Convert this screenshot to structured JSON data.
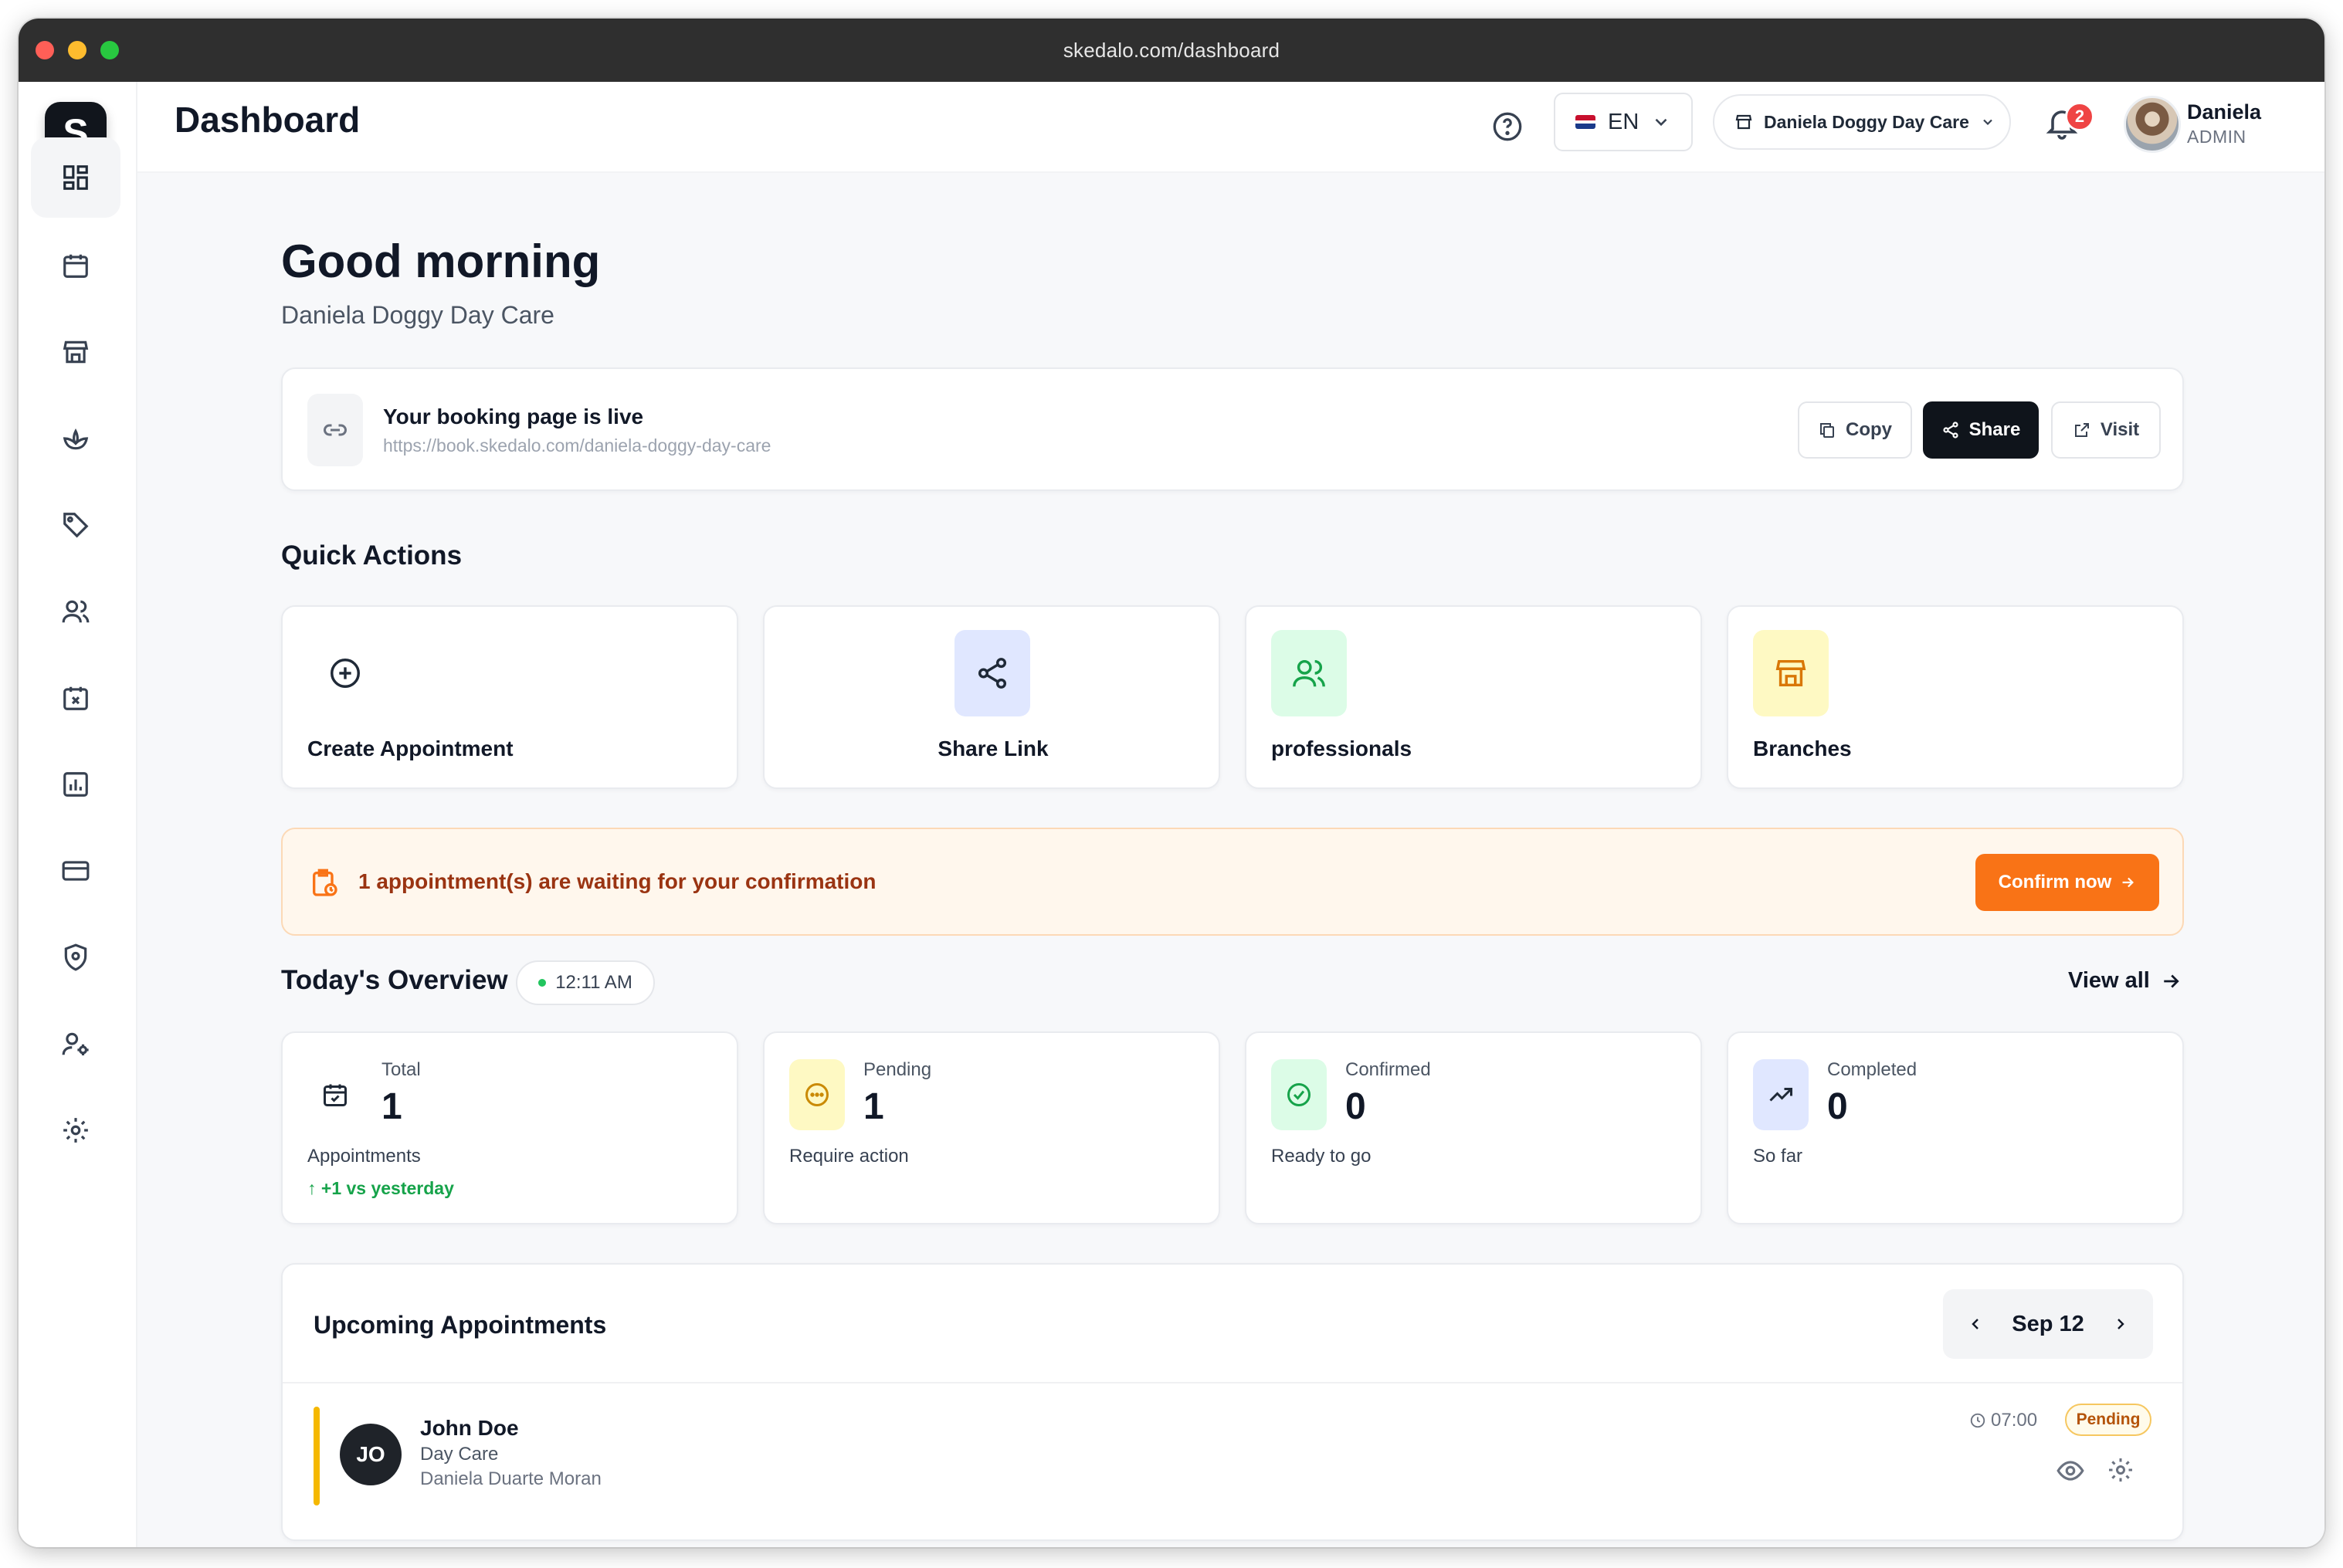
{
  "browser": {
    "url": "skedalo.com/dashboard"
  },
  "logo": {
    "letter": "S"
  },
  "sidebar": {
    "items": [
      {
        "icon": "dashboard-icon",
        "active": true
      },
      {
        "icon": "calendar-icon"
      },
      {
        "icon": "store-icon"
      },
      {
        "icon": "services-lotus-icon"
      },
      {
        "icon": "tag-icon"
      },
      {
        "icon": "users-icon"
      },
      {
        "icon": "calendar-x-icon"
      },
      {
        "icon": "bar-chart-icon"
      },
      {
        "icon": "credit-card-icon"
      },
      {
        "icon": "shield-icon"
      },
      {
        "icon": "user-settings-icon"
      },
      {
        "icon": "gear-icon"
      }
    ]
  },
  "header": {
    "title": "Dashboard",
    "language": "EN",
    "branch": "Daniela Doggy Day Care",
    "notifications_count": "2",
    "user_name": "Daniela",
    "user_role": "ADMIN"
  },
  "greeting": {
    "title": "Good morning",
    "subtitle": "Daniela Doggy Day Care"
  },
  "booking": {
    "title": "Your booking page is live",
    "url": "https://book.skedalo.com/daniela-doggy-day-care",
    "copy_label": "Copy",
    "share_label": "Share",
    "visit_label": "Visit"
  },
  "quick_actions": {
    "title": "Quick Actions",
    "items": [
      {
        "label": "Create Appointment",
        "icon": "plus-circle-icon"
      },
      {
        "label": "Share Link",
        "icon": "share-icon",
        "color": "#e0e7ff"
      },
      {
        "label": "professionals",
        "icon": "users-icon",
        "color": "#dcfce7"
      },
      {
        "label": "Branches",
        "icon": "store-icon",
        "color": "#fef9c3"
      }
    ]
  },
  "alert": {
    "text": "1 appointment(s) are waiting for your confirmation",
    "button": "Confirm now"
  },
  "overview": {
    "title": "Today's Overview",
    "time": "12:11 AM",
    "view_all": "View all",
    "stats": [
      {
        "label": "Total",
        "value": "1",
        "sub": "Appointments",
        "trend": "+1 vs yesterday",
        "icon": "calendar-check-icon"
      },
      {
        "label": "Pending",
        "value": "1",
        "sub": "Require action",
        "icon": "clock-dots-icon",
        "color": "#fef9c3"
      },
      {
        "label": "Confirmed",
        "value": "0",
        "sub": "Ready to go",
        "icon": "check-circle-icon",
        "color": "#dcfce7"
      },
      {
        "label": "Completed",
        "value": "0",
        "sub": "So far",
        "icon": "trending-up-icon",
        "color": "#e0e7ff"
      }
    ]
  },
  "upcoming": {
    "title": "Upcoming Appointments",
    "date": "Sep 12",
    "appointments": [
      {
        "initials": "JO",
        "name": "John Doe",
        "service": "Day Care",
        "staff": "Daniela Duarte Moran",
        "time": "07:00",
        "status": "Pending"
      }
    ]
  },
  "colors": {
    "accent_orange": "#f97316",
    "dark": "#0f141b",
    "pending_yellow": "#f5b800",
    "success_green": "#16a34a",
    "badge_red": "#ef4444"
  }
}
